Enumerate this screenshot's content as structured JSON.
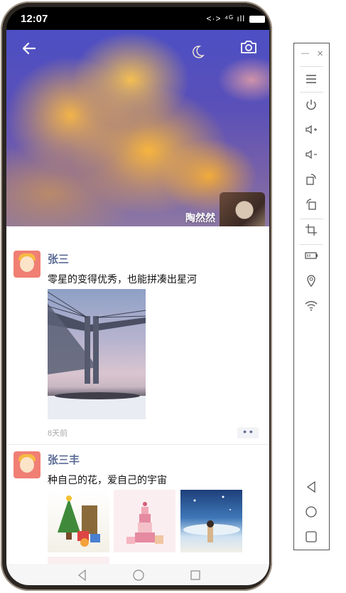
{
  "status_bar": {
    "time": "12:07",
    "icons": "<·> ⁴ᴳ ıll"
  },
  "profile": {
    "nickname": "陶然然"
  },
  "posts": [
    {
      "user": "张三",
      "text": "零星的变得优秀，也能拼凑出星河",
      "time": "8天前",
      "more": "• •"
    },
    {
      "user": "张三丰",
      "text": "种自己的花，爱自己的宇宙"
    }
  ],
  "colors": {
    "username": "#5b6b96",
    "avatar_bg": "#f07f74"
  },
  "icons": {
    "header": [
      "back-arrow-icon",
      "moon-icon",
      "camera-icon"
    ],
    "navbar": [
      "back-triangle-icon",
      "home-circle-icon",
      "recents-square-icon"
    ],
    "emulator_toolbar": [
      "minimize-icon",
      "close-icon",
      "menu-icon",
      "power-icon",
      "volume-up-icon",
      "volume-down-icon",
      "rotate-right-icon",
      "rotate-left-icon",
      "crop-icon",
      "battery-icon",
      "location-icon",
      "wifi-icon",
      "back-icon",
      "home-icon",
      "overview-icon"
    ]
  }
}
